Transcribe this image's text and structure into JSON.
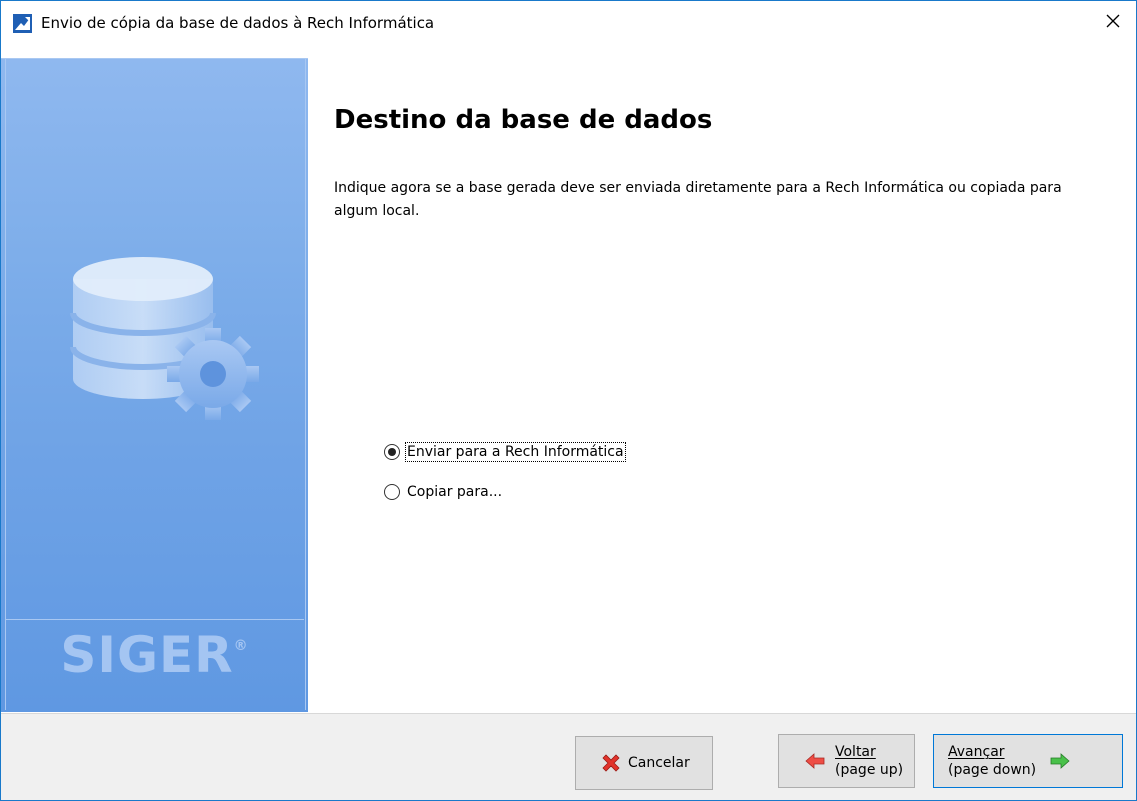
{
  "window": {
    "title": "Envio de cópia da base de dados à Rech Informática",
    "close_glyph": "✕",
    "app_icon": "siger-app-icon"
  },
  "banner": {
    "brand": "SIGER",
    "brand_mark": "®",
    "image": "database-gear-icon",
    "colors": {
      "top": "#8fb8ef",
      "bottom": "#5f98e2"
    }
  },
  "main": {
    "title": "Destino da base de dados",
    "description": "Indique agora se a base gerada deve ser enviada diretamente para a Rech Informática ou copiada para algum local.",
    "options": [
      {
        "label": "Enviar para a Rech Informática",
        "checked": true
      },
      {
        "label": "Copiar para...",
        "checked": false
      }
    ]
  },
  "footer": {
    "cancel": {
      "label": "Cancelar",
      "icon": "red-x-icon"
    },
    "back": {
      "line1": "Voltar",
      "line2": "(page up)",
      "icon": "red-left-arrow-icon"
    },
    "next": {
      "line1": "Avançar",
      "line2": "(page down)",
      "icon": "green-right-arrow-icon"
    }
  }
}
